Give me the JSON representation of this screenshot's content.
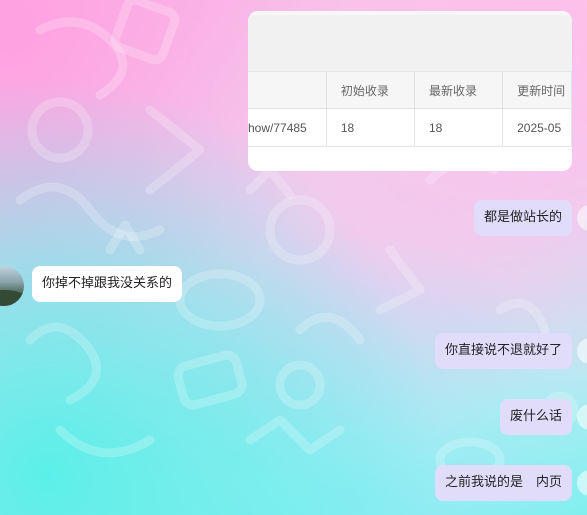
{
  "shared_table": {
    "headers": [
      "",
      "初始收录",
      "最新收录",
      "更新时间"
    ],
    "row": [
      "how/77485",
      "18",
      "18",
      "2025-05"
    ]
  },
  "messages": [
    {
      "side": "out",
      "text": "都是做站长的"
    },
    {
      "side": "in",
      "text": "你掉不掉跟我没关系的"
    },
    {
      "side": "out",
      "text": "你直接说不退就好了"
    },
    {
      "side": "out",
      "text": "废什么话"
    },
    {
      "side": "out",
      "text": "之前我说的是　内页"
    }
  ],
  "colors": {
    "outgoing_bubble": "#e2dcfb",
    "incoming_bubble": "#ffffff"
  }
}
